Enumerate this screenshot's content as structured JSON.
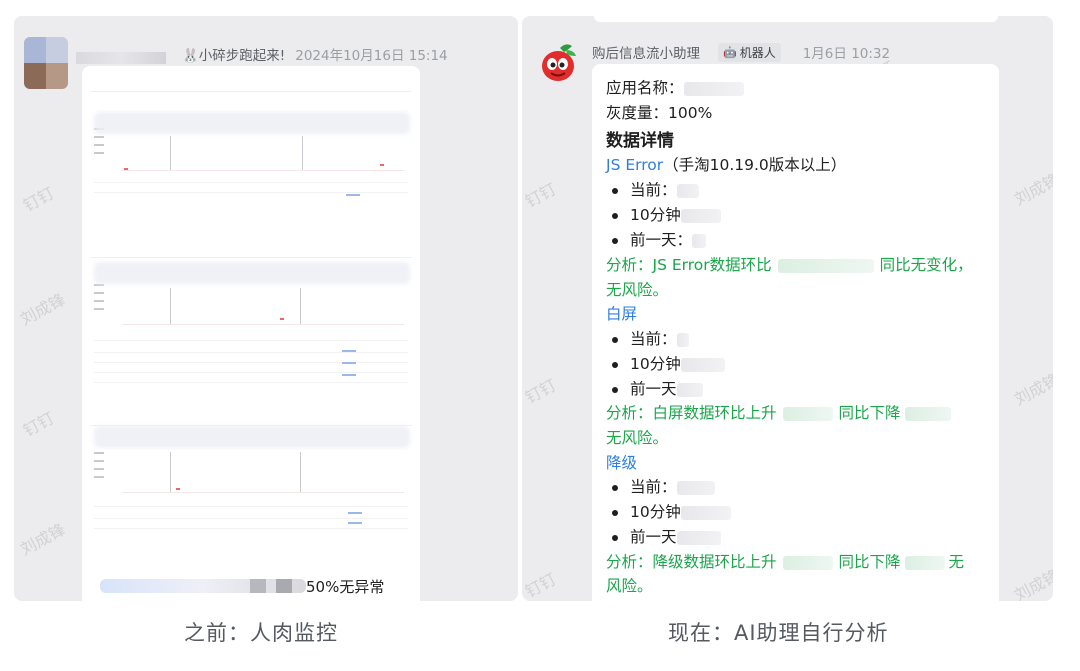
{
  "captions": {
    "left": "之前：人肉监控",
    "right": "现在：AI助理自行分析"
  },
  "watermark": "刘成锋",
  "watermark_alt": "钉钉",
  "left_message": {
    "sender": "🐰小碎步跑起来!",
    "time": "2024年10月16日 15:14",
    "bottom_text": "50%无异常"
  },
  "right_message": {
    "sender": "购后信息流小助理",
    "badge": "机器人",
    "time": "1月6日 10:32",
    "app_name_label": "应用名称：",
    "gray_label": "灰度量：100%",
    "details_title": "数据详情",
    "sections": [
      {
        "title": "JS Error",
        "title_suffix": "（手淘10.19.0版本以上）",
        "items": [
          "当前：",
          "10分钟",
          "前一天："
        ],
        "analysis_1": "分析：JS Error数据环比",
        "analysis_2": "同比无变化，",
        "analysis_3": "无风险。"
      },
      {
        "title": "白屏",
        "items": [
          "当前：",
          "10分钟",
          "前一天"
        ],
        "analysis_1": "分析：白屏数据环比上升",
        "analysis_2": "同比下降",
        "analysis_3": "无风险。"
      },
      {
        "title": "降级",
        "items": [
          "当前：",
          "10分钟",
          "前一天"
        ],
        "analysis_1": "分析：降级数据环比上升",
        "analysis_2": "同比下降",
        "analysis_3": "无",
        "analysis_4": "风险。"
      }
    ]
  },
  "colors": {
    "link_blue": "#2f7de1",
    "analysis_green": "#19a74a",
    "panel_bg": "#ececef"
  }
}
